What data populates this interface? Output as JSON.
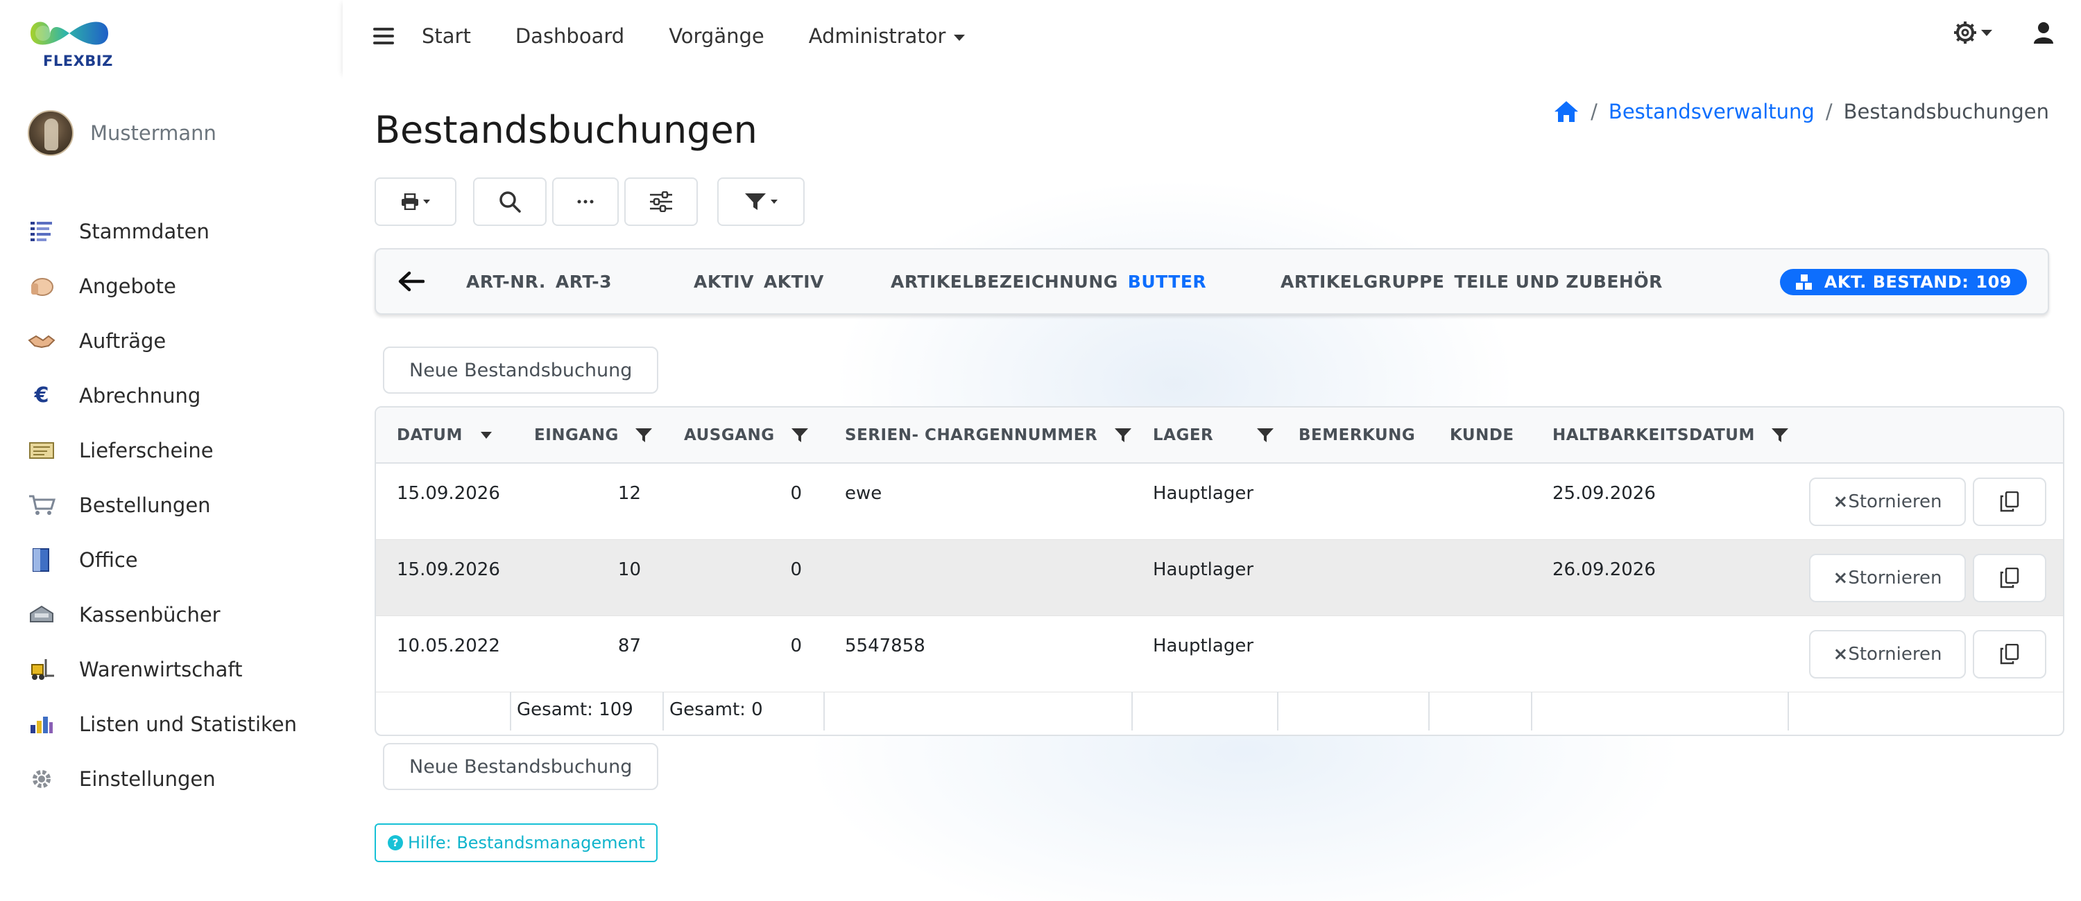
{
  "brand": {
    "name": "FLEXBIZ"
  },
  "user": {
    "name": "Mustermann"
  },
  "sidebar": {
    "items": [
      {
        "label": "Stammdaten",
        "icon": "list-icon"
      },
      {
        "label": "Angebote",
        "icon": "hand-icon"
      },
      {
        "label": "Aufträge",
        "icon": "handshake-icon"
      },
      {
        "label": "Abrechnung",
        "icon": "euro-icon"
      },
      {
        "label": "Lieferscheine",
        "icon": "delivery-note-icon"
      },
      {
        "label": "Bestellungen",
        "icon": "cart-icon"
      },
      {
        "label": "Office",
        "icon": "office-icon"
      },
      {
        "label": "Kassenbücher",
        "icon": "cash-register-icon"
      },
      {
        "label": "Warenwirtschaft",
        "icon": "forklift-icon"
      },
      {
        "label": "Listen und Statistiken",
        "icon": "bar-chart-icon"
      },
      {
        "label": "Einstellungen",
        "icon": "gear-icon"
      }
    ]
  },
  "topnav": {
    "items": [
      "Start",
      "Dashboard",
      "Vorgänge",
      "Administrator"
    ]
  },
  "page": {
    "title": "Bestandsbuchungen",
    "breadcrumb": {
      "parent": "Bestandsverwaltung",
      "current": "Bestandsbuchungen"
    }
  },
  "info": {
    "art_nr_label": "ART-NR.",
    "art_nr_value": "ART-3",
    "aktiv_label": "AKTIV",
    "aktiv_value": "AKTIV",
    "bezeichnung_label": "ARTIKELBEZEICHNUNG",
    "bezeichnung_value": "BUTTER",
    "gruppe_label": "ARTIKELGRUPPE",
    "gruppe_value": "TEILE UND ZUBEHÖR",
    "bestand_label": "AKT. BESTAND:",
    "bestand_value": "109"
  },
  "actions": {
    "new_booking": "Neue Bestandsbuchung",
    "storno": "Stornieren",
    "help": "Hilfe: Bestandsmanagement"
  },
  "table": {
    "headers": {
      "datum": "DATUM",
      "eingang": "EINGANG",
      "ausgang": "AUSGANG",
      "serie": "SERIEN- CHARGENNUMMER",
      "lager": "LAGER",
      "bemerkung": "BEMERKUNG",
      "kunde": "KUNDE",
      "haltbarkeit": "HALTBARKEITSDATUM"
    },
    "rows": [
      {
        "datum": "15.09.2026",
        "eingang": "12",
        "ausgang": "0",
        "serie": "ewe",
        "lager": "Hauptlager",
        "bemerkung": "",
        "kunde": "",
        "haltbarkeit": "25.09.2026"
      },
      {
        "datum": "15.09.2026",
        "eingang": "10",
        "ausgang": "0",
        "serie": "",
        "lager": "Hauptlager",
        "bemerkung": "",
        "kunde": "",
        "haltbarkeit": "26.09.2026"
      },
      {
        "datum": "10.05.2022",
        "eingang": "87",
        "ausgang": "0",
        "serie": "5547858",
        "lager": "Hauptlager",
        "bemerkung": "",
        "kunde": "",
        "haltbarkeit": ""
      }
    ],
    "totals": {
      "eingang": "Gesamt: 109",
      "ausgang": "Gesamt: 0"
    }
  },
  "colors": {
    "accent": "#0d6efd",
    "help": "#17c1d6",
    "brand_dark": "#1d3d8f"
  }
}
